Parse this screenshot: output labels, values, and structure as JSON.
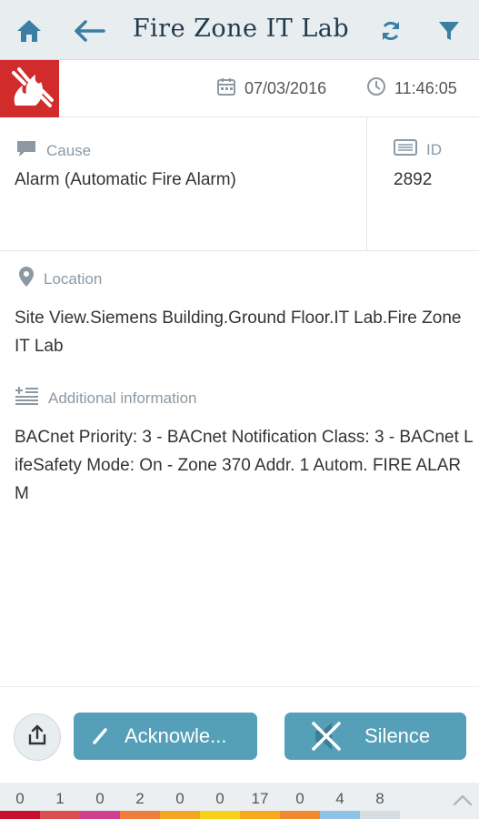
{
  "header": {
    "title": "Fire Zone IT Lab",
    "icons": {
      "home": "home-icon",
      "back": "back-arrow-icon",
      "refresh": "refresh-icon",
      "filter": "filter-icon"
    }
  },
  "event": {
    "date": "07/03/2016",
    "time": "11:46:05",
    "badge_icon": "fire-icon",
    "badge_color": "#d22b2b"
  },
  "cause": {
    "label": "Cause",
    "value": "Alarm (Automatic Fire Alarm)"
  },
  "id": {
    "label": "ID",
    "value": "2892"
  },
  "location": {
    "label": "Location",
    "value": "Site View.Siemens Building.Ground Floor.IT Lab.Fire Zone IT Lab"
  },
  "additional": {
    "label": "Additional information",
    "value": "BACnet Priority: 3 - BACnet Notification Class: 3 - BACnet LifeSafety Mode: On - Zone 370 Addr. 1 Autom. FIRE ALARM"
  },
  "actions": {
    "acknowledge": "Acknowle...",
    "silence": "Silence",
    "accent_color": "#55a0b8"
  },
  "counters": [
    {
      "value": "0",
      "color": "#c8102e"
    },
    {
      "value": "1",
      "color": "#d94e4e"
    },
    {
      "value": "0",
      "color": "#d23f8f"
    },
    {
      "value": "2",
      "color": "#ef7d3c"
    },
    {
      "value": "0",
      "color": "#f5a623"
    },
    {
      "value": "0",
      "color": "#f7d117"
    },
    {
      "value": "17",
      "color": "#f7a81b"
    },
    {
      "value": "0",
      "color": "#ef8a2e"
    },
    {
      "value": "4",
      "color": "#8fc3e6"
    },
    {
      "value": "8",
      "color": "#d5dde2"
    }
  ]
}
